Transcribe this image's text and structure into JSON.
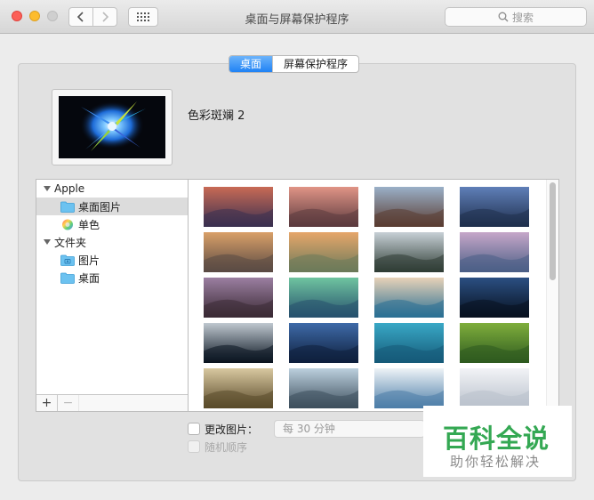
{
  "window": {
    "title": "桌面与屏幕保护程序",
    "search_placeholder": "搜索"
  },
  "tabs": [
    {
      "label": "桌面",
      "active": true
    },
    {
      "label": "屏幕保护程序",
      "active": false
    }
  ],
  "current_wallpaper": {
    "name": "色彩斑斓 2"
  },
  "source_list": {
    "groups": [
      {
        "label": "Apple",
        "expanded": true,
        "items": [
          {
            "label": "桌面图片",
            "icon": "folder-icon",
            "selected": true
          },
          {
            "label": "单色",
            "icon": "color-wheel-icon",
            "selected": false
          }
        ]
      },
      {
        "label": "文件夹",
        "expanded": true,
        "items": [
          {
            "label": "图片",
            "icon": "photos-folder-icon",
            "selected": false
          },
          {
            "label": "桌面",
            "icon": "folder-icon",
            "selected": false
          }
        ]
      }
    ],
    "add_button": "+",
    "remove_button": "−"
  },
  "gallery": {
    "thumbnails": [
      {
        "name": "sierra-mountains",
        "colors": [
          "#c86a55",
          "#3a3050"
        ]
      },
      {
        "name": "sierra-dusk",
        "colors": [
          "#e09486",
          "#5b3a3e"
        ]
      },
      {
        "name": "el-capitan",
        "colors": [
          "#9ab0c8",
          "#5a3c32"
        ]
      },
      {
        "name": "blue-ridge",
        "colors": [
          "#5f7fb8",
          "#1f2f4d"
        ]
      },
      {
        "name": "yosemite-rock",
        "colors": [
          "#d9a068",
          "#5a4a44"
        ]
      },
      {
        "name": "half-dome-sunset",
        "colors": [
          "#e6a66a",
          "#6b7a5a"
        ]
      },
      {
        "name": "forest-mist",
        "colors": [
          "#c7d0d6",
          "#2f3d35"
        ]
      },
      {
        "name": "yosemite-valley",
        "colors": [
          "#c6a7c9",
          "#4b5f86"
        ]
      },
      {
        "name": "lake-rocks",
        "colors": [
          "#9b7fa1",
          "#3a2a34"
        ]
      },
      {
        "name": "green-wave",
        "colors": [
          "#6fc4a0",
          "#27516d"
        ]
      },
      {
        "name": "ocean-wave",
        "colors": [
          "#e8d2b8",
          "#2a6f93"
        ]
      },
      {
        "name": "earth-night",
        "colors": [
          "#2b4f82",
          "#07111f"
        ]
      },
      {
        "name": "earth-orbit",
        "colors": [
          "#bfc8d0",
          "#0a1420"
        ]
      },
      {
        "name": "milky-way",
        "colors": [
          "#3e6aa8",
          "#0e1f3c"
        ]
      },
      {
        "name": "river-delta",
        "colors": [
          "#39a8c6",
          "#155a78"
        ]
      },
      {
        "name": "rice-terraces",
        "colors": [
          "#7fae3c",
          "#2e5a1f"
        ]
      },
      {
        "name": "golden-fog",
        "colors": [
          "#d8c8a0",
          "#5a4a2a"
        ]
      },
      {
        "name": "blue-hills",
        "colors": [
          "#bcd0de",
          "#3d4e5c"
        ]
      },
      {
        "name": "ice-floe",
        "colors": [
          "#eef3f7",
          "#4d7ea8"
        ]
      },
      {
        "name": "white-dunes",
        "colors": [
          "#f2f3f6",
          "#b9c1cc"
        ]
      }
    ]
  },
  "options": {
    "change_picture_label": "更改图片：",
    "change_picture_checked": false,
    "interval_value": "每 30 分钟",
    "random_order_label": "随机顺序",
    "random_order_checked": false
  },
  "watermark": {
    "title": "百科全说",
    "subtitle": "助你轻松解决"
  }
}
